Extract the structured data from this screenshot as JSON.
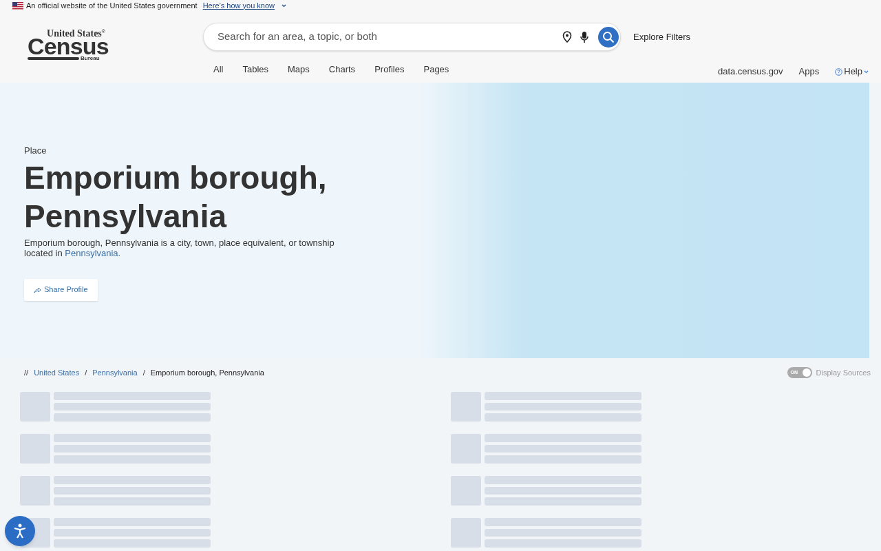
{
  "gov_banner": {
    "text": "An official website of the United States government",
    "link": "Here’s how you know"
  },
  "logo": {
    "top": "United States",
    "mark": "®",
    "main": "Census",
    "bottom": "Bureau"
  },
  "search": {
    "placeholder": "Search for an area, a topic, or both"
  },
  "explore_filters": "Explore Filters",
  "nav_tabs": [
    "All",
    "Tables",
    "Maps",
    "Charts",
    "Profiles",
    "Pages"
  ],
  "utility_links": [
    "data.census.gov",
    "Apps",
    "Help"
  ],
  "hero": {
    "eyebrow": "Place",
    "title": "Emporium borough, Pennsylvania",
    "description": "Emporium borough, Pennsylvania is a city, town, place equivalent, or township located in ",
    "description_link": "Pennsylvania.",
    "share_button": "Share Profile"
  },
  "breadcrumb": {
    "prefix": "//",
    "separator": "/",
    "items": [
      {
        "label": "United States",
        "link": true
      },
      {
        "label": "Pennsylvania",
        "link": true
      },
      {
        "label": "Emporium borough, Pennsylvania",
        "link": false
      }
    ]
  },
  "display_sources": {
    "toggle_text": "ON",
    "on": true,
    "label": "Display Sources"
  }
}
